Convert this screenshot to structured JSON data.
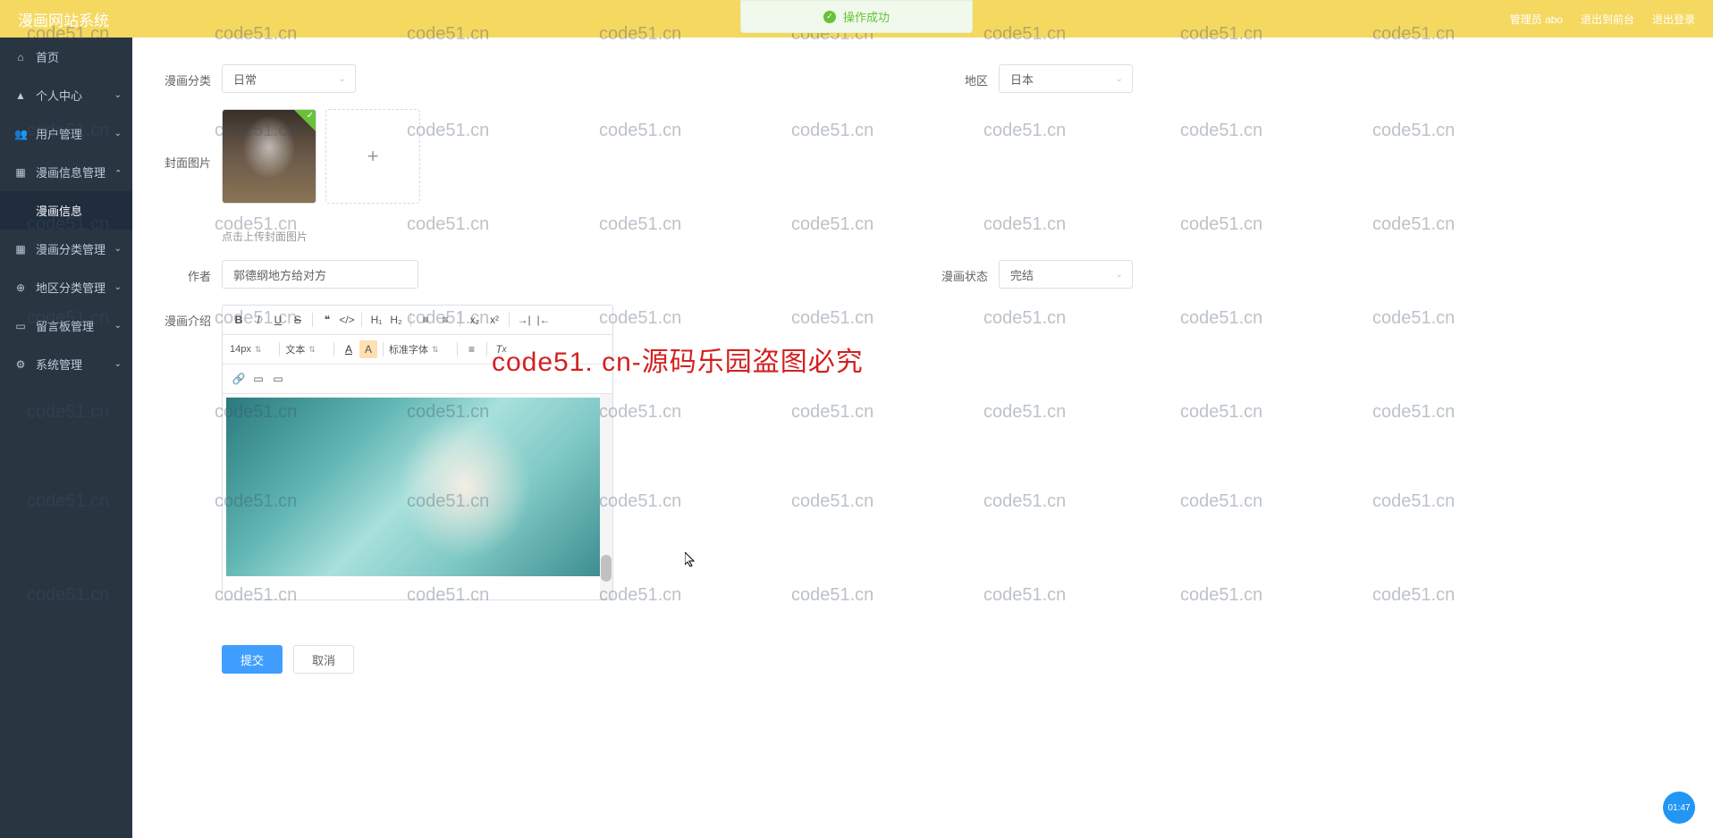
{
  "header": {
    "title": "漫画网站系统",
    "admin_label": "管理员 abo",
    "exit_console": "退出到前台",
    "logout": "退出登录"
  },
  "toast": {
    "text": "操作成功"
  },
  "sidebar": {
    "items": [
      {
        "icon": "home",
        "label": "首页",
        "arrow": false
      },
      {
        "icon": "user",
        "label": "个人中心",
        "arrow": true,
        "open": false
      },
      {
        "icon": "users",
        "label": "用户管理",
        "arrow": true,
        "open": false
      },
      {
        "icon": "grid",
        "label": "漫画信息管理",
        "arrow": true,
        "open": true
      },
      {
        "icon": "grid2",
        "label": "漫画分类管理",
        "arrow": true,
        "open": false
      },
      {
        "icon": "globe",
        "label": "地区分类管理",
        "arrow": true,
        "open": false
      },
      {
        "icon": "chat",
        "label": "留言板管理",
        "arrow": true,
        "open": false
      },
      {
        "icon": "gear",
        "label": "系统管理",
        "arrow": true,
        "open": false
      }
    ],
    "submenu_label": "漫画信息"
  },
  "form": {
    "category_label": "漫画分类",
    "category_value": "日常",
    "region_label": "地区",
    "region_value": "日本",
    "cover_label": "封面图片",
    "upload_hint": "点击上传封面图片",
    "author_label": "作者",
    "author_value": "郭德纲地方给对方",
    "status_label": "漫画状态",
    "status_value": "完结",
    "intro_label": "漫画介绍",
    "submit": "提交",
    "cancel": "取消"
  },
  "editor": {
    "font_size": "14px",
    "format": "文本",
    "font_family": "标准字体"
  },
  "watermark_text": "code51.cn",
  "watermark_red": "code51. cn-源码乐园盗图必究",
  "timer": "01:47"
}
